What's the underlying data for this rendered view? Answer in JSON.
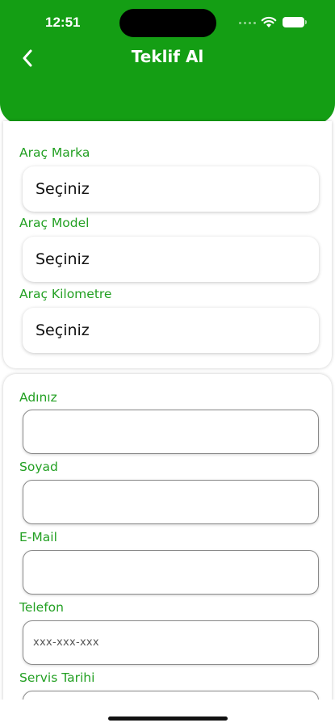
{
  "status_bar": {
    "time": "12:51"
  },
  "header": {
    "title": "Teklif Al"
  },
  "vehicle": {
    "brand_label": "Araç Marka",
    "brand_value": "Seçiniz",
    "model_label": "Araç Model",
    "model_value": "Seçiniz",
    "km_label": "Araç Kilometre",
    "km_value": "Seçiniz"
  },
  "contact": {
    "name_label": "Adınız",
    "name_value": "",
    "surname_label": "Soyad",
    "surname_value": "",
    "email_label": "E-Mail",
    "email_value": "",
    "phone_label": "Telefon",
    "phone_placeholder": "xxx-xxx-xxx",
    "service_date_label": "Servis Tarihi"
  },
  "colors": {
    "accent": "#149e14",
    "label": "#23a023"
  },
  "icons": {
    "back": "chevron-left-icon",
    "wifi": "wifi-icon",
    "battery": "battery-icon"
  }
}
